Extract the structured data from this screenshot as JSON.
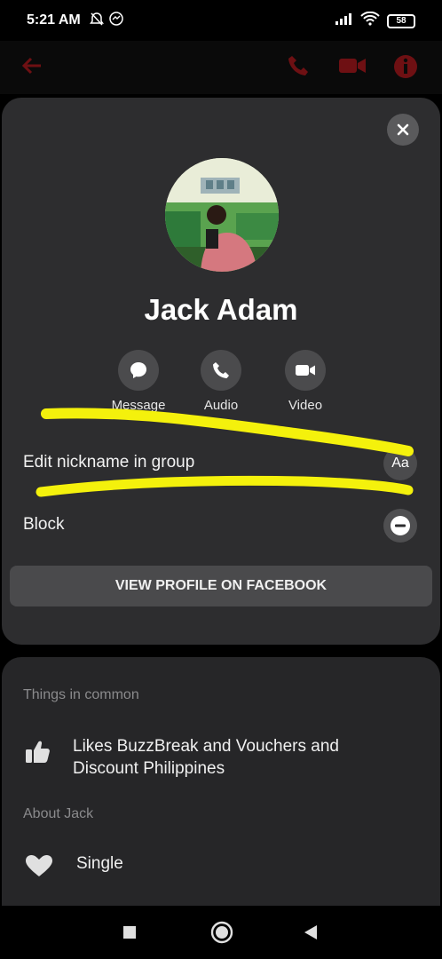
{
  "status_bar": {
    "time": "5:21 AM",
    "battery": "58"
  },
  "profile": {
    "name": "Jack Adam"
  },
  "actions": [
    {
      "label": "Message",
      "icon": "message-bubble-icon"
    },
    {
      "label": "Audio",
      "icon": "phone-icon"
    },
    {
      "label": "Video",
      "icon": "video-camera-icon"
    }
  ],
  "options": {
    "edit_nickname": "Edit nickname in group",
    "edit_nickname_icon_text": "Aa",
    "block": "Block"
  },
  "view_profile_button": "VIEW PROFILE ON FACEBOOK",
  "things_in_common": {
    "title": "Things in common",
    "likes_line1": "Likes BuzzBreak and Vouchers and",
    "likes_line2": "Discount Philippines"
  },
  "about": {
    "title": "About Jack",
    "relationship": "Single"
  },
  "colors": {
    "background": "#000000",
    "card": "#2d2d2f",
    "button": "#4b4b4d",
    "highlighter": "#f4f10c",
    "top_bar_icons": "#c0161c"
  }
}
